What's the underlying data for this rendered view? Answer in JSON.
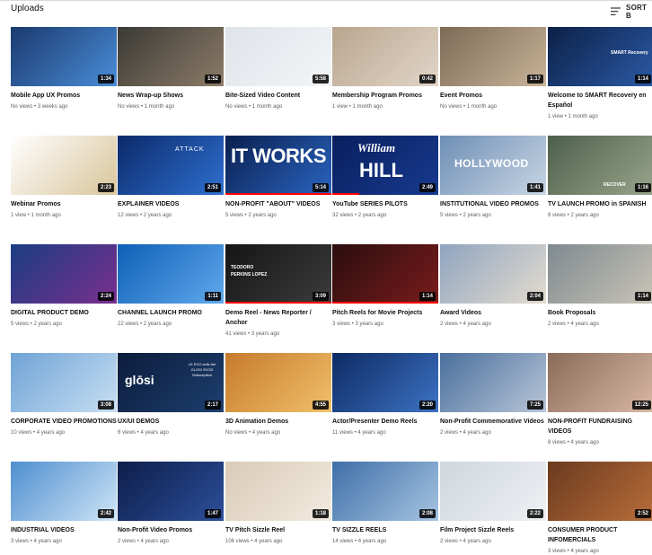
{
  "header": {
    "title": "Uploads",
    "sort_label": "SORT B"
  },
  "videos": [
    [
      {
        "title": "Mobile App UX Promos",
        "meta": "No views • 3 weeks ago",
        "duration": "1:34",
        "bg": [
          "#1a3a6e",
          "#4a8dd8"
        ]
      },
      {
        "title": "News Wrap-up Shows",
        "meta": "No views • 1 month ago",
        "duration": "1:52",
        "bg": [
          "#3b3a36",
          "#8c7c68"
        ]
      },
      {
        "title": "Bite-Sized Video Content",
        "meta": "No views • 1 month ago",
        "duration": "5:58",
        "bg": [
          "#dfe4ea",
          "#f3f5f7"
        ]
      },
      {
        "title": "Membership Program Promos",
        "meta": "1 view • 1 month ago",
        "duration": "0:42",
        "bg": [
          "#b9a58e",
          "#e2d6c8"
        ]
      },
      {
        "title": "Event Promos",
        "meta": "No views • 1 month ago",
        "duration": "1:17",
        "bg": [
          "#7d6a55",
          "#c9b49a"
        ]
      },
      {
        "title": "Welcome to SMART Recovery en Español",
        "meta": "1 view • 1 month ago",
        "duration": "1:14",
        "bg": [
          "#0c2047",
          "#2c5aa6"
        ]
      }
    ],
    [
      {
        "title": "Webinar Promos",
        "meta": "1 view • 1 month ago",
        "duration": "2:23",
        "bg": [
          "#ffffff",
          "#d8c59a"
        ]
      },
      {
        "title": "EXPLAINER VIDEOS",
        "meta": "12 views • 2 years ago",
        "duration": "2:51",
        "bg": [
          "#0b2a6a",
          "#2f6fd0"
        ]
      },
      {
        "title": "NON-PROFIT \"ABOUT\" VIDEOS",
        "meta": "5 views • 2 years ago",
        "duration": "5:14",
        "bg": [
          "#0a1f4f",
          "#2a64c0"
        ]
      },
      {
        "title": "YouTube SERIES PILOTS",
        "meta": "32 views • 2 years ago",
        "duration": "2:49",
        "bg": [
          "#0a1f5e",
          "#173a8f"
        ]
      },
      {
        "title": "INSTITUTIONAL VIDEO PROMOS",
        "meta": "5 views • 2 years ago",
        "duration": "1:41",
        "bg": [
          "#6f8fb5",
          "#c8d6e4"
        ]
      },
      {
        "title": "TV LAUNCH PROMO in SPANISH",
        "meta": "8 views • 2 years ago",
        "duration": "1:16",
        "bg": [
          "#4d5f4a",
          "#9aa58c"
        ]
      }
    ],
    [
      {
        "title": "DIGITAL PRODUCT DEMO",
        "meta": "5 views • 2 years ago",
        "duration": "2:24",
        "bg": [
          "#1b3d82",
          "#7a2f8e"
        ]
      },
      {
        "title": "CHANNEL LAUNCH PROMO",
        "meta": "22 views • 2 years ago",
        "duration": "1:11",
        "bg": [
          "#0f5fb7",
          "#60a9ec"
        ]
      },
      {
        "title": "Demo Reel - News Reporter / Anchor",
        "meta": "41 views • 3 years ago",
        "duration": "3:09",
        "bg": [
          "#151515",
          "#3c3c3c"
        ]
      },
      {
        "title": "Pitch Reels for Movie Projects",
        "meta": "3 views • 3 years ago",
        "duration": "1:14",
        "bg": [
          "#2a0d0d",
          "#7a1c1c"
        ]
      },
      {
        "title": "Award Videos",
        "meta": "2 views • 4 years ago",
        "duration": "2:04",
        "bg": [
          "#8fa4bf",
          "#e4dccf"
        ]
      },
      {
        "title": "Book Proposals",
        "meta": "2 views • 4 years ago",
        "duration": "1:14",
        "bg": [
          "#7f8a8f",
          "#c9c4b8"
        ]
      }
    ],
    [
      {
        "title": "CORPORATE VIDEO PROMOTIONS",
        "meta": "10 views • 4 years ago",
        "duration": "3:08",
        "bg": [
          "#6fa3d6",
          "#c8dff2"
        ]
      },
      {
        "title": "UX/UI DEMOS",
        "meta": "6 views • 4 years ago",
        "duration": "2:17",
        "bg": [
          "#0b1c3b",
          "#1e3f6f"
        ]
      },
      {
        "title": "3D Animation Demos",
        "meta": "No views • 4 years ago",
        "duration": "4:55",
        "bg": [
          "#c77b2c",
          "#f0c06a"
        ]
      },
      {
        "title": "Actor/Presenter Demo Reels",
        "meta": "11 views • 4 years ago",
        "duration": "2:20",
        "bg": [
          "#0d2a63",
          "#3d73c4"
        ]
      },
      {
        "title": "Non-Profit Commemorative Videos",
        "meta": "2 views • 4 years ago",
        "duration": "7:25",
        "bg": [
          "#4a6f9c",
          "#b8c6d8"
        ]
      },
      {
        "title": "NON-PROFIT FUNDRAISING VIDEOS",
        "meta": "8 views • 4 years ago",
        "duration": "12:25",
        "bg": [
          "#8a6a58",
          "#d9b9a6"
        ]
      }
    ],
    [
      {
        "title": "INDUSTRIAL VIDEOS",
        "meta": "3 views • 4 years ago",
        "duration": "2:42",
        "bg": [
          "#4f8fd0",
          "#cfe5f6"
        ]
      },
      {
        "title": "Non-Profit Video Promos",
        "meta": "2 views • 4 years ago",
        "duration": "1:47",
        "bg": [
          "#0d1e4a",
          "#2d4f9a"
        ]
      },
      {
        "title": "TV Pitch Sizzle Reel",
        "meta": "106 views • 4 years ago",
        "duration": "1:18",
        "bg": [
          "#d9cbb6",
          "#f2ebe0"
        ]
      },
      {
        "title": "TV SIZZLE REELS",
        "meta": "14 views • 4 years ago",
        "duration": "2:08",
        "bg": [
          "#3f6fa8",
          "#a6c4e2"
        ]
      },
      {
        "title": "Film Project Sizzle Reels",
        "meta": "2 views • 4 years ago",
        "duration": "2:22",
        "bg": [
          "#cfd6dd",
          "#eef1f4"
        ]
      },
      {
        "title": "CONSUMER PRODUCT INFOMERCIALS",
        "meta": "3 views • 4 years ago",
        "duration": "2:52",
        "bg": [
          "#6b3a1f",
          "#b86e3a"
        ]
      }
    ]
  ],
  "overlay_text": {
    "smart": "SMART Recovery",
    "attack": "ATTACK",
    "itworks": "IT WORKS",
    "william": "William",
    "hill": "HILL",
    "hollywood": "HOLLYWOOD",
    "recover": "RECOVER",
    "teodoro": "TEODORO PERKINS LOPEZ",
    "glosi": "glōsi",
    "uxtext": "LE ECO sells the GLOSI SVOD Subscription"
  }
}
